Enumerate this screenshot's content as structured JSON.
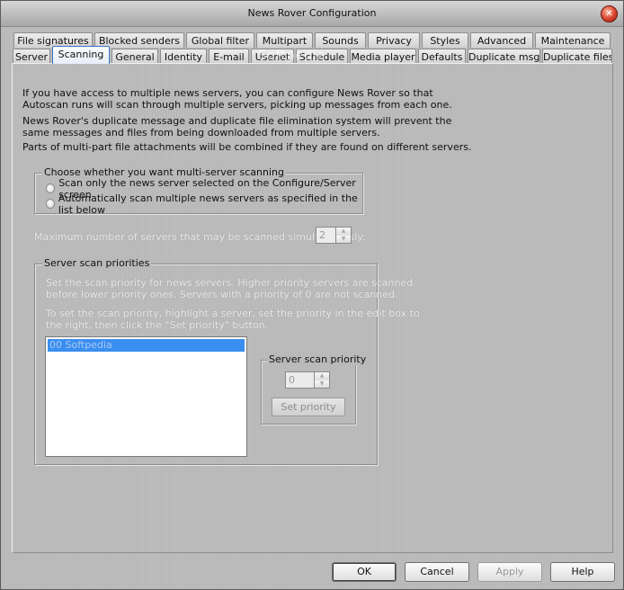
{
  "window": {
    "title": "News Rover Configuration"
  },
  "tabs_row1": [
    {
      "label": "File signatures"
    },
    {
      "label": "Blocked senders"
    },
    {
      "label": "Global filter"
    },
    {
      "label": "Multipart"
    },
    {
      "label": "Sounds"
    },
    {
      "label": "Privacy"
    },
    {
      "label": "Styles"
    },
    {
      "label": "Advanced"
    },
    {
      "label": "Maintenance"
    }
  ],
  "tabs_row2": [
    {
      "label": "Server"
    },
    {
      "label": "Scanning",
      "active": true
    },
    {
      "label": "General"
    },
    {
      "label": "Identity"
    },
    {
      "label": "E-mail"
    },
    {
      "label": "Usenet"
    },
    {
      "label": "Schedule"
    },
    {
      "label": "Media player"
    },
    {
      "label": "Defaults"
    },
    {
      "label": "Duplicate msg"
    },
    {
      "label": "Duplicate files"
    }
  ],
  "intro": {
    "p1_line1": "If you have access to multiple news servers, you can configure News Rover so that",
    "p1_line2": "Autoscan runs will scan through multiple servers, picking up messages from each one.",
    "p2_line1": "News Rover's duplicate message and duplicate file elimination system will prevent the",
    "p2_line2": "same messages and files from being downloaded from multiple servers.",
    "p3_line1": "Parts of multi-part file attachments will be combined if they are found on different servers."
  },
  "scan_mode": {
    "legend": "Choose whether you want multi-server scanning",
    "option_single": "Scan only the news server selected on the Configure/Server screen",
    "option_multi": "Automatically scan multiple news servers as specified in the list below"
  },
  "max_servers": {
    "label": "Maximum number of servers that may be scanned simultaneously:",
    "value": "2"
  },
  "priorities": {
    "legend": "Server scan priorities",
    "desc_line1": "Set the scan priority for news servers.  Higher priority servers are scanned",
    "desc_line2": "before lower priority ones.  Servers with a priority of 0 are not scanned.",
    "desc_line3": "To set the scan priority, highlight a server, set the priority in the edit box to",
    "desc_line4": "the right, then click the \"Set priority\" button.",
    "servers": [
      "00  Softpedia"
    ],
    "priority_legend": "Server scan priority",
    "priority_value": "0",
    "set_priority_label": "Set priority"
  },
  "buttons": {
    "ok": "OK",
    "cancel": "Cancel",
    "apply": "Apply",
    "help": "Help"
  },
  "watermark": "Softpedia",
  "colors": {
    "selection": "#3a8ef0",
    "active_tab_border": "#3a76c4",
    "close_button": "#d8412d"
  }
}
